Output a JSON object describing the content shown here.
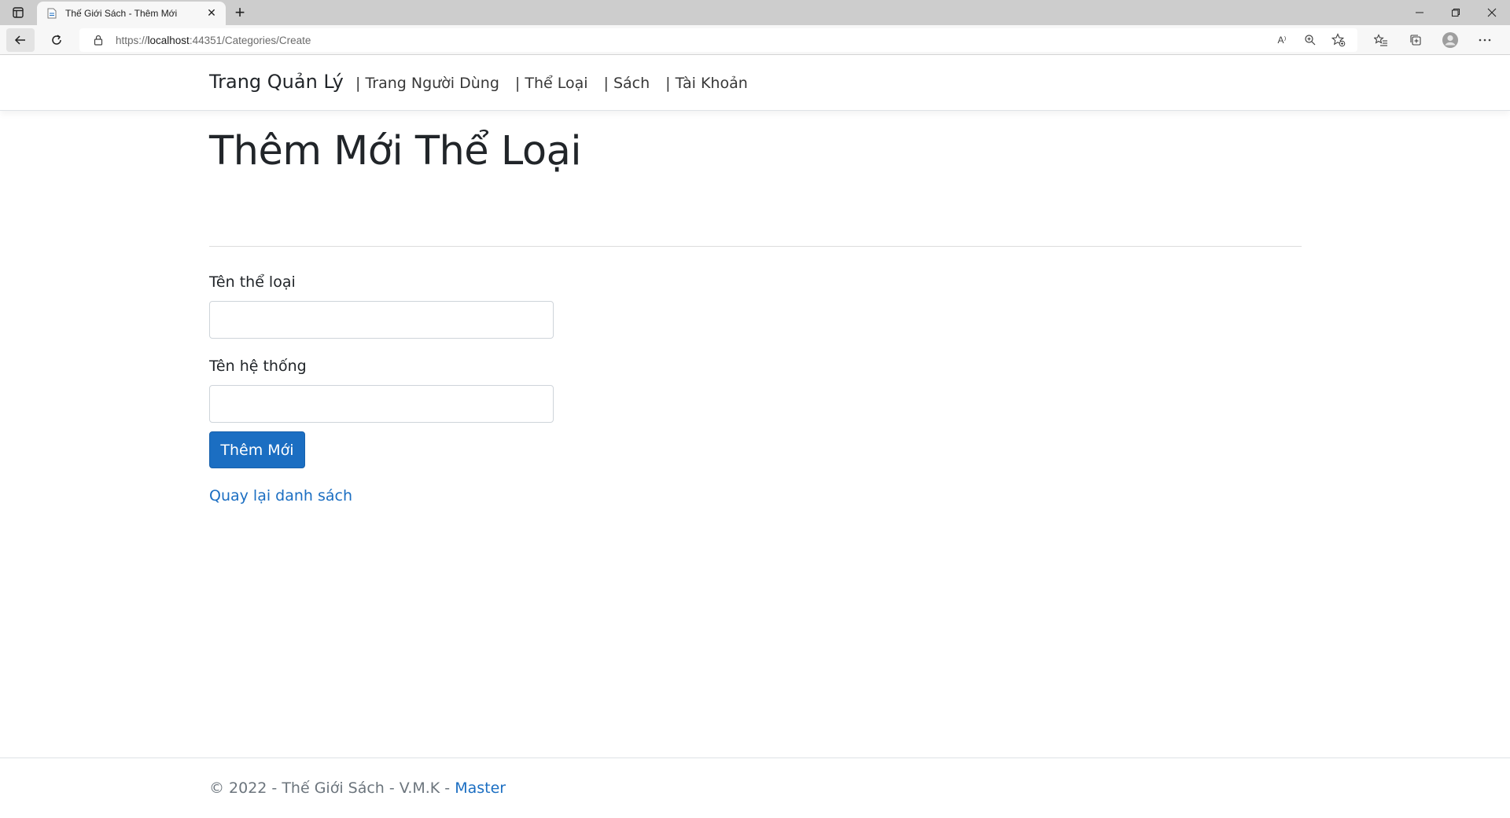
{
  "browser": {
    "tab_title": "Thế Giới Sách - Thêm Mới",
    "url_scheme": "https://",
    "url_host": "localhost",
    "url_rest": ":44351/Categories/Create",
    "read_aloud_label": "A⁾"
  },
  "navbar": {
    "brand": "Trang Quản Lý",
    "links": [
      {
        "label": "| Trang Người Dùng"
      },
      {
        "label": "| Thể Loại"
      },
      {
        "label": "| Sách"
      },
      {
        "label": "| Tài Khoản"
      }
    ]
  },
  "main": {
    "heading": "Thêm Mới Thể Loại",
    "fields": [
      {
        "label": "Tên thể loại",
        "value": ""
      },
      {
        "label": "Tên hệ thống",
        "value": ""
      }
    ],
    "submit_label": "Thêm Mới",
    "back_link": "Quay lại danh sách"
  },
  "footer": {
    "text": "© 2022 - Thế Giới Sách - V.M.K - ",
    "link": "Master"
  },
  "colors": {
    "accent": "#1b6ec2",
    "footer_text": "#6c757d"
  }
}
